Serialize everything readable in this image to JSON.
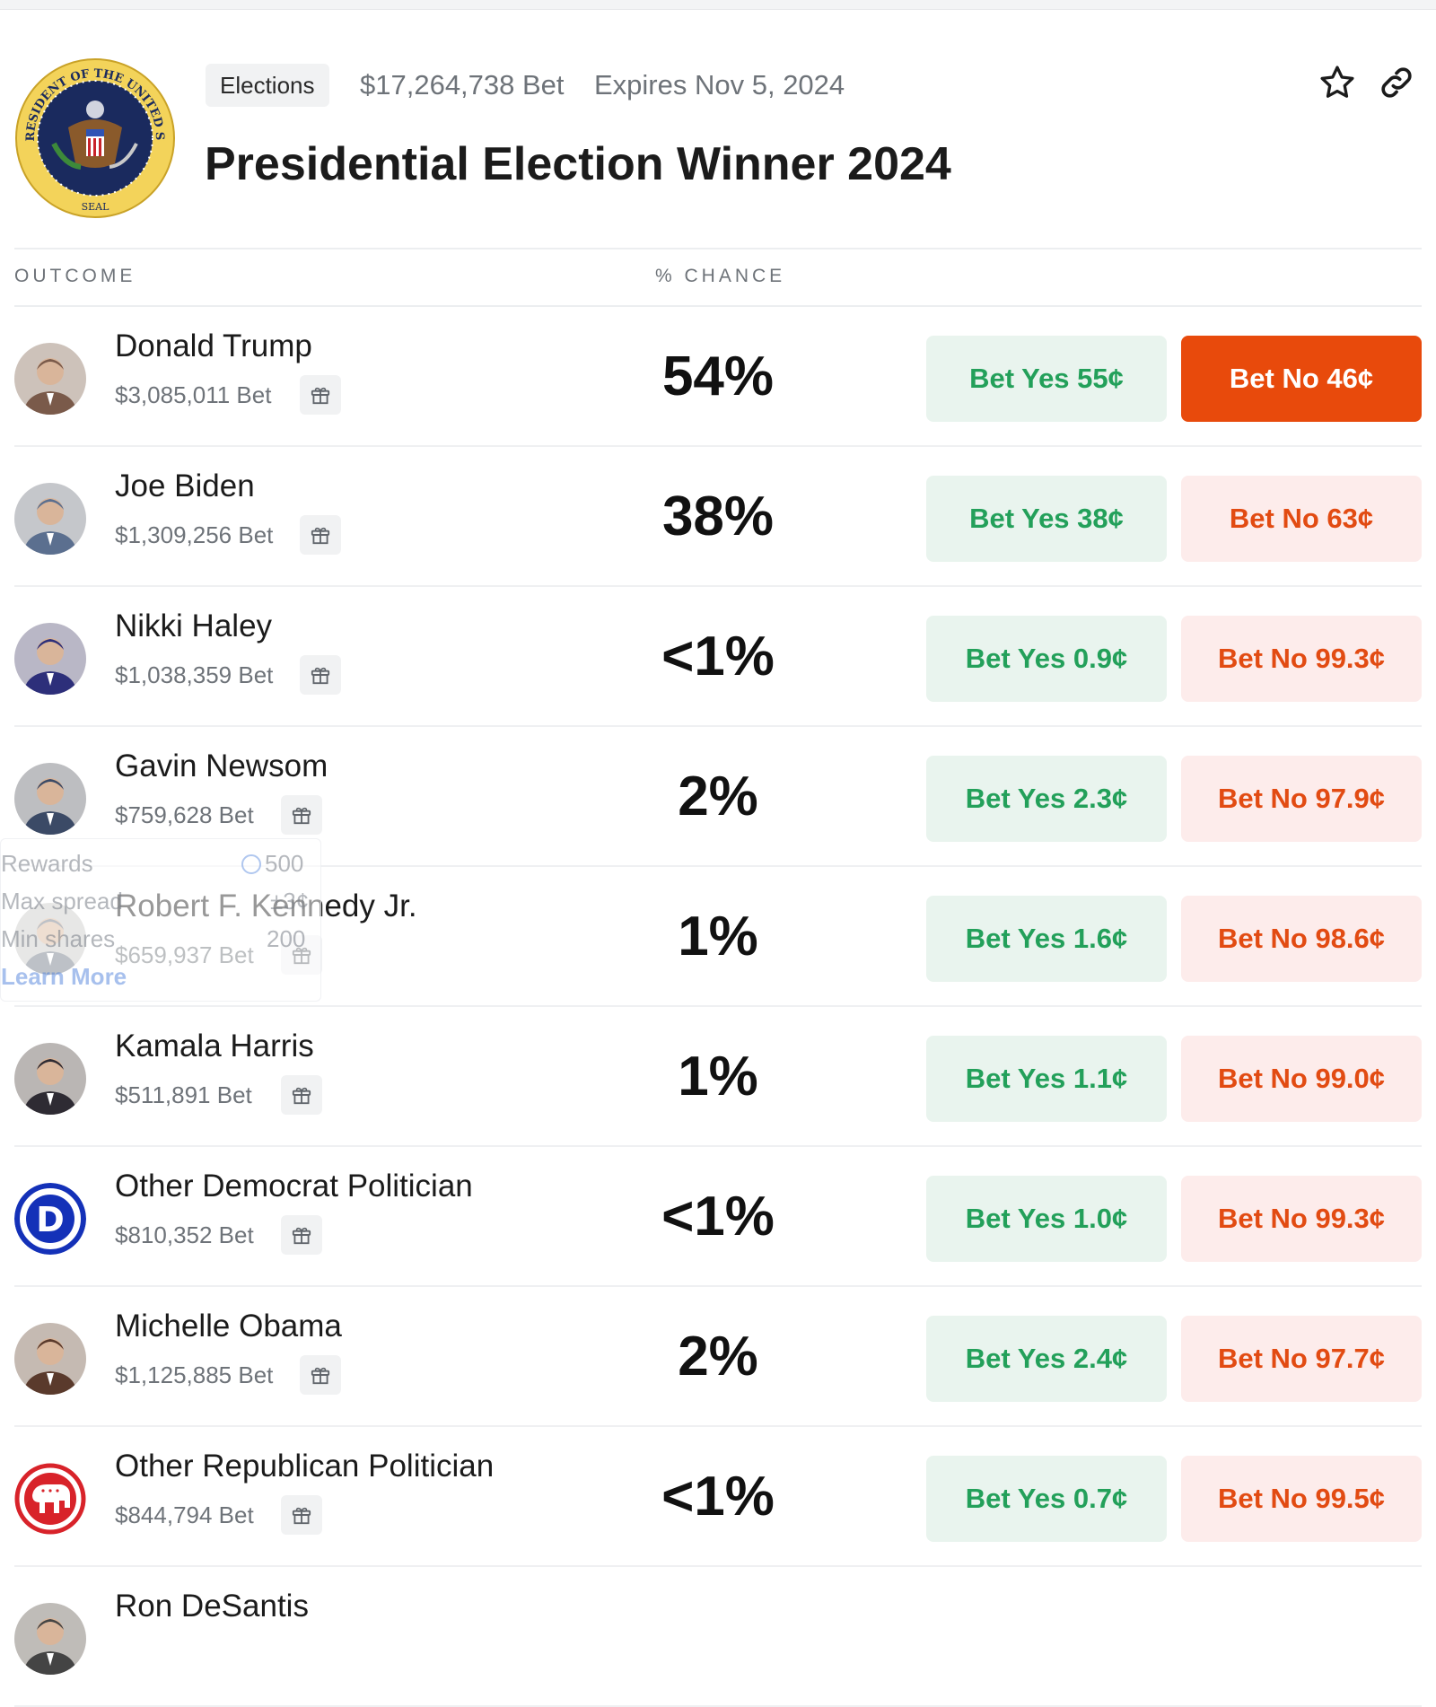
{
  "header": {
    "category": "Elections",
    "volume": "$17,264,738 Bet",
    "expires": "Expires Nov 5, 2024",
    "title": "Presidential Election Winner 2024",
    "seal_text_top": "THE PRESIDENT OF THE UNITED STATES",
    "seal_text_bottom": "SEAL",
    "icons": [
      "seal-icon",
      "star-icon",
      "link-icon"
    ]
  },
  "columns": {
    "outcome": "OUTCOME",
    "chance": "% CHANCE"
  },
  "rows": [
    {
      "name": "Donald Trump",
      "bet": "$3,085,011 Bet",
      "pct": "54%",
      "yes": "Bet Yes 55¢",
      "no": "Bet No 46¢",
      "avatar": "photo",
      "avatar_color": "#7a5a4a"
    },
    {
      "name": "Joe Biden",
      "bet": "$1,309,256 Bet",
      "pct": "38%",
      "yes": "Bet Yes 38¢",
      "no": "Bet No 63¢",
      "avatar": "photo",
      "avatar_color": "#5b6f8f"
    },
    {
      "name": "Nikki Haley",
      "bet": "$1,038,359 Bet",
      "pct": "<1%",
      "yes": "Bet Yes 0.9¢",
      "no": "Bet No 99.3¢",
      "avatar": "photo",
      "avatar_color": "#2d2f7a"
    },
    {
      "name": "Gavin Newsom",
      "bet": "$759,628 Bet",
      "pct": "2%",
      "yes": "Bet Yes 2.3¢",
      "no": "Bet No 97.9¢",
      "avatar": "photo",
      "avatar_color": "#3b4a66"
    },
    {
      "name": "Robert F. Kennedy Jr.",
      "bet": "$659,937 Bet",
      "pct": "1%",
      "yes": "Bet Yes 1.6¢",
      "no": "Bet No 98.6¢",
      "avatar": "photo",
      "avatar_color": "#6d7784"
    },
    {
      "name": "Kamala Harris",
      "bet": "$511,891 Bet",
      "pct": "1%",
      "yes": "Bet Yes 1.1¢",
      "no": "Bet No 99.0¢",
      "avatar": "photo",
      "avatar_color": "#2e2b33"
    },
    {
      "name": "Other Democrat Politician",
      "bet": "$810,352 Bet",
      "pct": "<1%",
      "yes": "Bet Yes 1.0¢",
      "no": "Bet No 99.3¢",
      "avatar": "democrat-logo",
      "avatar_color": "#1431b8"
    },
    {
      "name": "Michelle Obama",
      "bet": "$1,125,885 Bet",
      "pct": "2%",
      "yes": "Bet Yes 2.4¢",
      "no": "Bet No 97.7¢",
      "avatar": "photo",
      "avatar_color": "#5a3a2c"
    },
    {
      "name": "Other Republican Politician",
      "bet": "$844,794 Bet",
      "pct": "<1%",
      "yes": "Bet Yes 0.7¢",
      "no": "Bet No 99.5¢",
      "avatar": "republican-logo",
      "avatar_color": "#d8232a"
    },
    {
      "name": "Ron DeSantis",
      "bet": "",
      "pct": "",
      "yes": "",
      "no": "",
      "avatar": "photo",
      "avatar_color": "#444"
    }
  ],
  "popover": {
    "rewards_label": "Rewards",
    "rewards_value": "500",
    "max_spread_label": "Max spread",
    "max_spread_value": "±3¢",
    "min_shares_label": "Min shares",
    "min_shares_value": "200",
    "learn_more": "Learn More"
  },
  "colors": {
    "yes_bg": "#e9f4ee",
    "yes_text": "#23a05a",
    "no_bg": "#fdeceb",
    "no_text": "#e24b12",
    "no_active_bg": "#e84a0c"
  }
}
